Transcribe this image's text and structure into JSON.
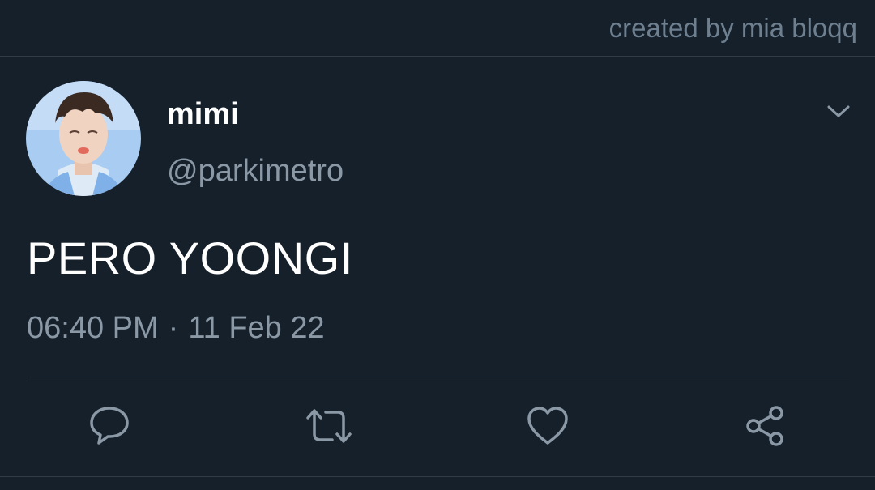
{
  "watermark": "created by mia bloqq",
  "tweet": {
    "author": {
      "display_name": "mimi",
      "handle": "@parkimetro",
      "avatar_icon": "profile-photo"
    },
    "text": "PERO YOONGI",
    "time": "06:40 PM",
    "separator": "·",
    "date": "11 Feb 22"
  },
  "actions": [
    {
      "name": "reply",
      "icon": "speech-bubble-icon"
    },
    {
      "name": "retweet",
      "icon": "retweet-icon"
    },
    {
      "name": "like",
      "icon": "heart-icon"
    },
    {
      "name": "share",
      "icon": "share-icon"
    }
  ],
  "colors": {
    "background": "#15202b",
    "primary_text": "#ffffff",
    "secondary_text": "#8b98a5",
    "divider": "#2f3c48"
  }
}
